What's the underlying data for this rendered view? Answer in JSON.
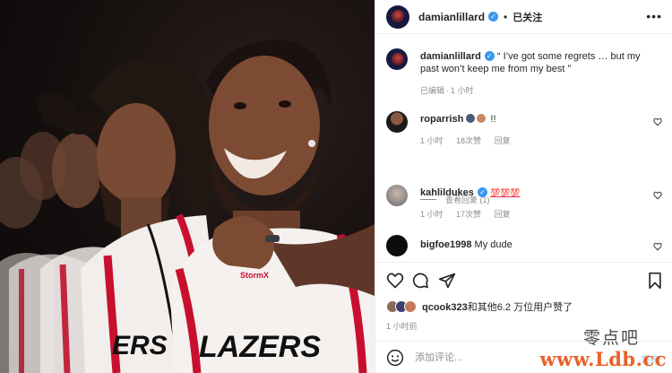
{
  "header": {
    "username": "damianlillard",
    "separator": "•",
    "follow_label": "已关注",
    "more_icon": "more-dots-icon"
  },
  "caption": {
    "username": "damianlillard",
    "text": "“ I’ve got some regrets … but my past won’t keep me from my best ”",
    "edited": "已编辑",
    "dot": "·",
    "time": "1 小时"
  },
  "comments": [
    {
      "username": "roparrish",
      "text": "!!",
      "time": "1 小时",
      "likes": "18次赞",
      "reply": "回复"
    },
    {
      "username": "kahlildukes",
      "text": "💯💯💯",
      "time": "1 小时",
      "likes": "17次赞",
      "reply": "回复"
    },
    {
      "username": "bigfoe1998",
      "text": "My dude"
    }
  ],
  "view_replies": "查看回复 (1)",
  "likes": {
    "first_user": "qcook323",
    "rest": "和其他6.2 万位用户赞了"
  },
  "post_time": "1 小时前",
  "comment_box": {
    "placeholder": "添加评论...",
    "post_label": "发布"
  },
  "watermark": {
    "top": "零点吧",
    "bottom": "www.Ldb.cc"
  },
  "photo": {
    "jersey_text": "BLAZERS",
    "sponsor_text": "Stormx"
  },
  "colors": {
    "verified_blue": "#3897f0",
    "text": "#262626",
    "muted": "#8e8e8e",
    "jersey_red": "#c8102e"
  }
}
